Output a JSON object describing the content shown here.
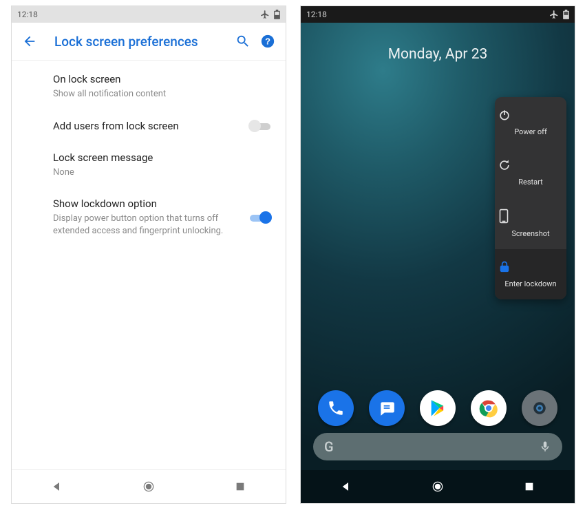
{
  "left": {
    "statusbar": {
      "time": "12:18"
    },
    "header": {
      "title": "Lock screen preferences"
    },
    "items": [
      {
        "title": "On lock screen",
        "subtitle": "Show all notification content"
      },
      {
        "title": "Add users from lock screen"
      },
      {
        "title": "Lock screen message",
        "subtitle": "None"
      },
      {
        "title": "Show lockdown option",
        "subtitle": "Display power button option that turns off extended access and fingerprint unlocking."
      }
    ]
  },
  "right": {
    "statusbar": {
      "time": "12:18"
    },
    "date": "Monday, Apr 23",
    "power_menu": [
      {
        "label": "Power off"
      },
      {
        "label": "Restart"
      },
      {
        "label": "Screenshot"
      },
      {
        "label": "Enter lockdown"
      }
    ],
    "search": {
      "logo": "G"
    }
  }
}
